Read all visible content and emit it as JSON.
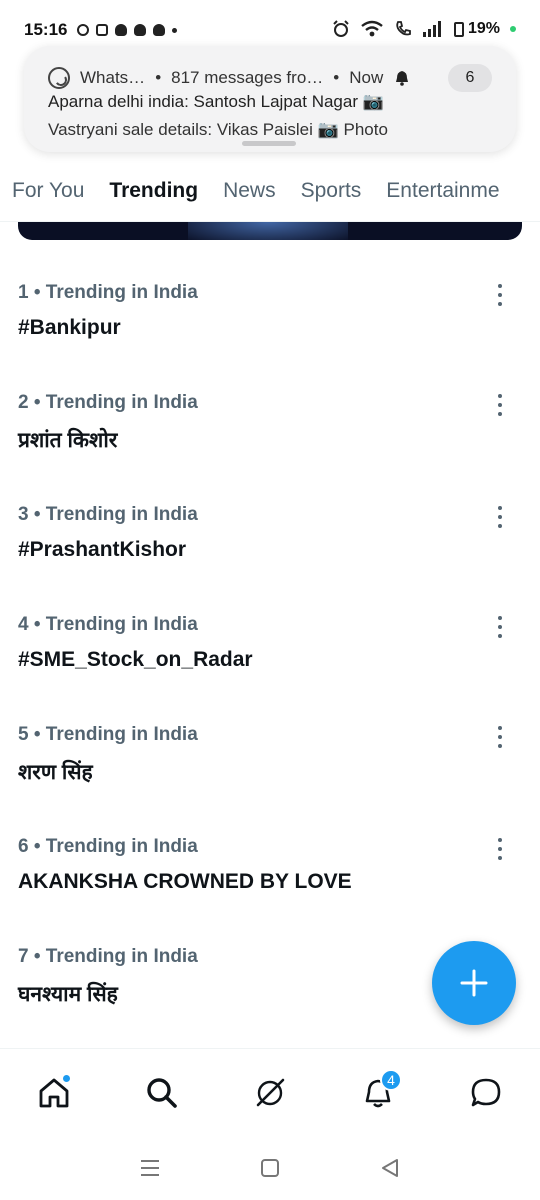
{
  "status_bar": {
    "time": "15:16",
    "battery": "19%"
  },
  "notification": {
    "app": "Whats…",
    "sep1": "•",
    "summary": "817 messages fro…",
    "sep2": "•",
    "when": "Now",
    "count": "6",
    "line1": "Aparna delhi india: Santosh Lajpat Nagar 📷",
    "line2": "Vastryani sale details: Vikas Paislei 📷 Photo"
  },
  "tabs": [
    {
      "label": "For You"
    },
    {
      "label": "Trending"
    },
    {
      "label": "News"
    },
    {
      "label": "Sports"
    },
    {
      "label": "Entertainme"
    }
  ],
  "trends": [
    {
      "meta": "1 • Trending in India",
      "name": "#Bankipur"
    },
    {
      "meta": "2 • Trending in India",
      "name": "प्रशांत किशोर"
    },
    {
      "meta": "3 • Trending in India",
      "name": "#PrashantKishor"
    },
    {
      "meta": "4 • Trending in India",
      "name": "#SME_Stock_on_Radar"
    },
    {
      "meta": "5 • Trending in India",
      "name": "शरण सिंह"
    },
    {
      "meta": "6 • Trending in India",
      "name": "AKANKSHA CROWNED BY LOVE"
    },
    {
      "meta": "7 • Trending in India",
      "name": "घनश्याम सिंह"
    }
  ],
  "bottom_nav": {
    "notifications_badge": "4"
  },
  "colors": {
    "accent": "#1d9bf0",
    "text_primary": "#0f1419",
    "text_secondary": "#536471"
  }
}
